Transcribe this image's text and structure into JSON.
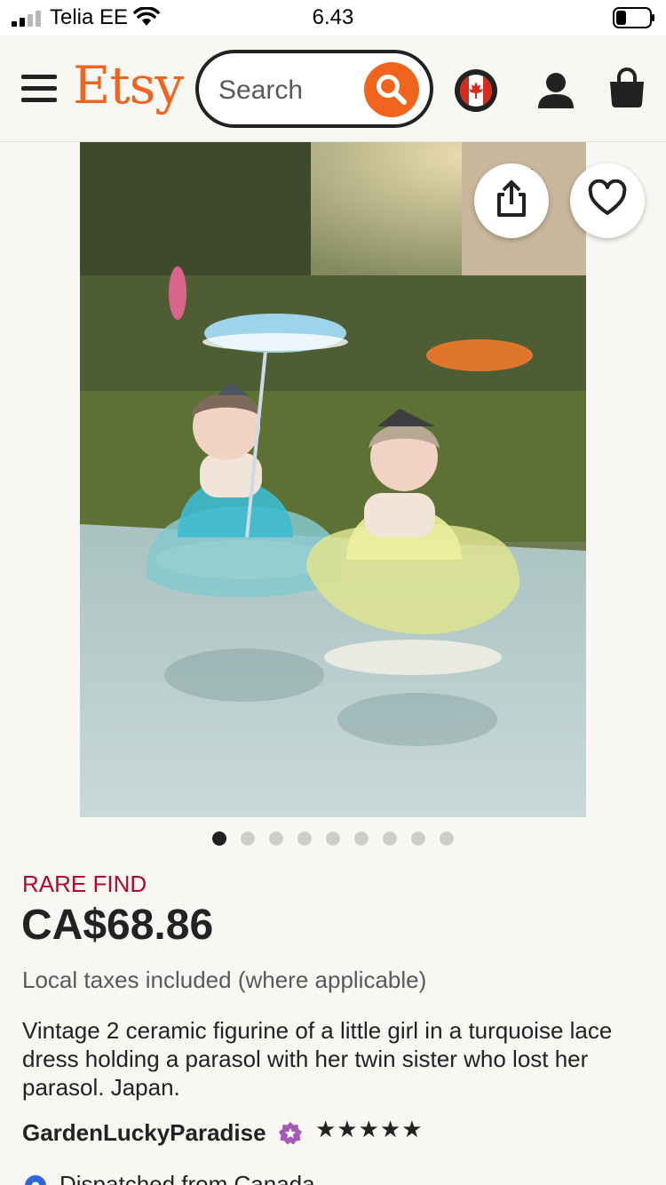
{
  "status_bar": {
    "carrier": "Telia EE",
    "time": "6.43",
    "signal_icon": "signal-bars-icon",
    "wifi_icon": "wifi-icon",
    "battery_icon": "battery-icon",
    "battery_level": 0.3
  },
  "header": {
    "menu_icon": "hamburger-menu-icon",
    "logo": "Etsy",
    "search_placeholder": "Search",
    "search_icon": "search-icon",
    "region_icon": "canada-flag-icon",
    "account_icon": "user-icon",
    "cart_icon": "shopping-bag-icon"
  },
  "gallery": {
    "share_icon": "share-icon",
    "favorite_icon": "heart-icon",
    "image_count": 9,
    "active_index": 0
  },
  "listing": {
    "badge": "RARE FIND",
    "price": "CA$68.86",
    "tax_note": "Local taxes included (where applicable)",
    "description": "Vintage 2 ceramic figurine of a little girl in a turquoise lace dress holding a parasol with her twin sister who lost her parasol. Japan.",
    "shop_name": "GardenLuckyParadise",
    "star_seller_icon": "star-seller-badge-icon",
    "rating_stars": "★★★★★",
    "rating": 5,
    "dispatch": "Dispatched from Canada",
    "dispatch_icon": "location-pin-icon"
  },
  "colors": {
    "brand": "#f1641e",
    "rare_find": "#b3082c",
    "star_seller": "#a35bb5"
  }
}
